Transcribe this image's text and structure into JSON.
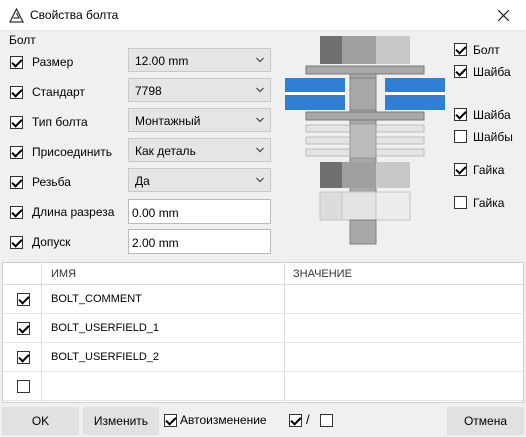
{
  "window": {
    "title": "Свойства болта"
  },
  "group": {
    "label": "Болт"
  },
  "params": [
    {
      "label": "Размер",
      "checked": true,
      "control": "combo",
      "value": "12.00 mm"
    },
    {
      "label": "Стандарт",
      "checked": true,
      "control": "combo",
      "value": "7798"
    },
    {
      "label": "Тип болта",
      "checked": true,
      "control": "combo",
      "value": "Монтажный"
    },
    {
      "label": "Присоединить",
      "checked": true,
      "control": "combo",
      "value": "Как деталь"
    },
    {
      "label": "Резьба",
      "checked": true,
      "control": "combo",
      "value": "Да"
    },
    {
      "label": "Длина разреза",
      "checked": true,
      "control": "text",
      "value": "0.00 mm"
    },
    {
      "label": "Допуск",
      "checked": true,
      "control": "text",
      "value": "2.00 mm"
    }
  ],
  "assembly_options": [
    {
      "label": "Болт",
      "checked": true
    },
    {
      "label": "Шайба",
      "checked": true
    },
    {
      "label": "Шайба",
      "checked": true
    },
    {
      "label": "Шайбы",
      "checked": false
    },
    {
      "label": "Гайка",
      "checked": true
    },
    {
      "label": "Гайка",
      "checked": false
    }
  ],
  "table": {
    "headers": [
      "ИМЯ",
      "ЗНАЧЕНИЕ"
    ],
    "rows": [
      {
        "name": "BOLT_COMMENT",
        "value": "",
        "checked": true
      },
      {
        "name": "BOLT_USERFIELD_1",
        "value": "",
        "checked": true
      },
      {
        "name": "BOLT_USERFIELD_2",
        "value": "",
        "checked": true
      },
      {
        "name": "",
        "value": "",
        "checked": false
      }
    ]
  },
  "footer": {
    "ok_label": "OK",
    "modify_label": "Изменить",
    "auto_label": "Автоизменение",
    "auto_checked": true,
    "slash": "/",
    "cancel_label": "Отмена"
  },
  "colors": {
    "washer_highlight": "#2f7fd4",
    "bolt_dark": "#707070",
    "bolt_mid": "#a0a0a0",
    "bolt_light": "#c8c8c8"
  }
}
